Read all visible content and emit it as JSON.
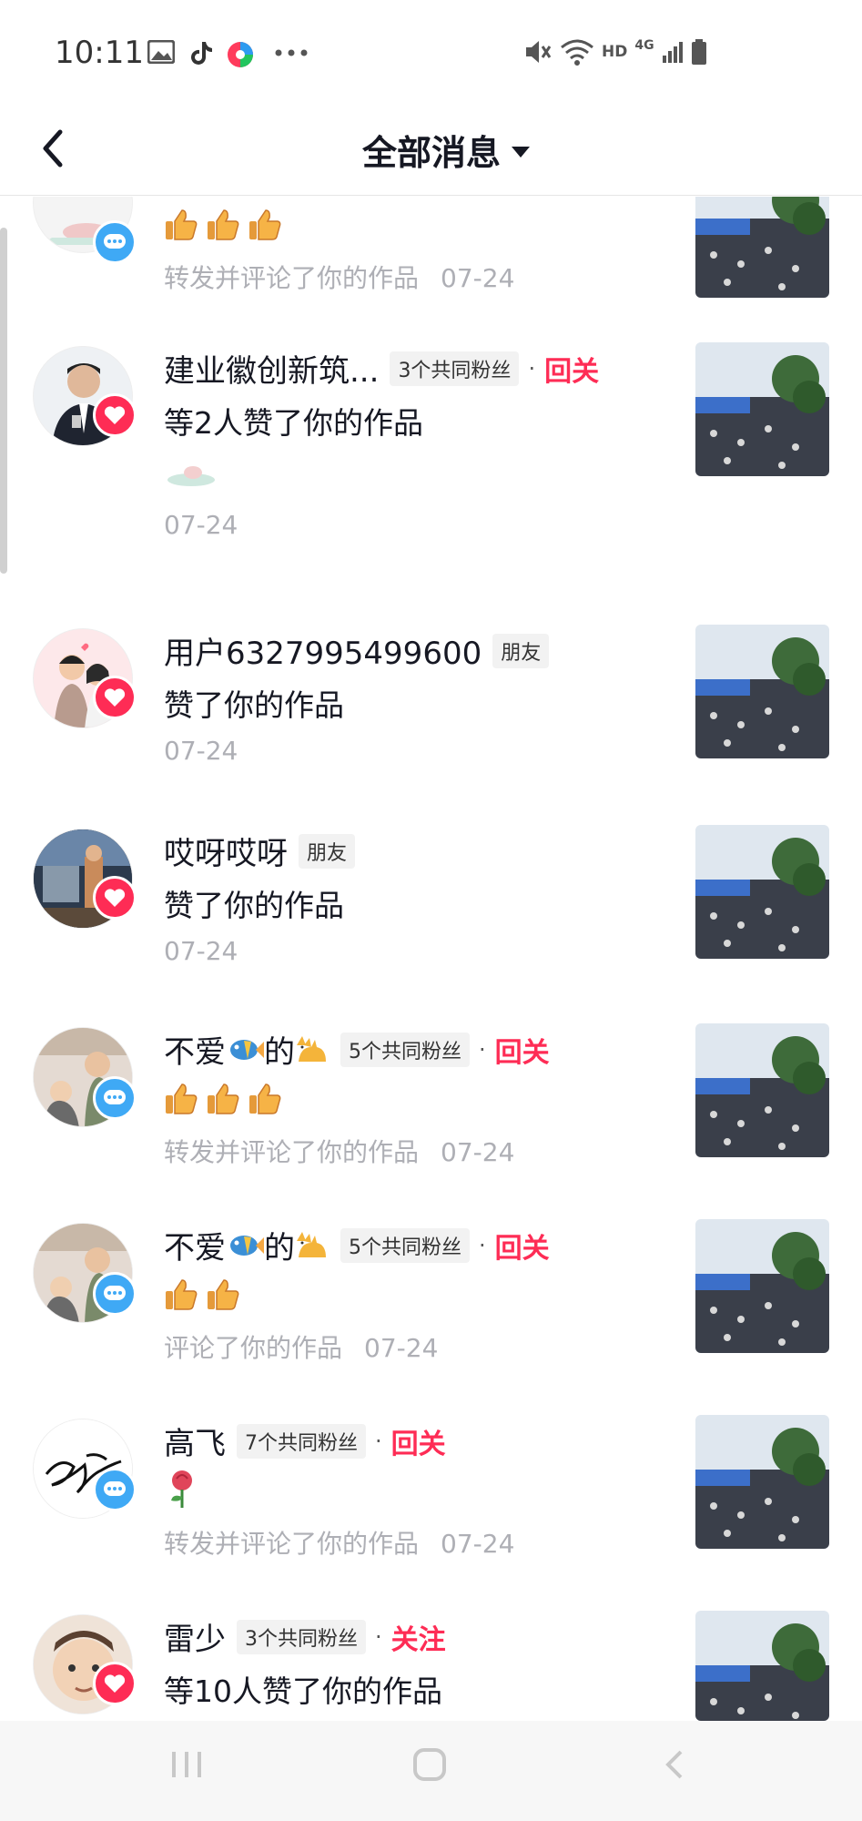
{
  "status_bar": {
    "time": "10:11",
    "network": "4G",
    "hd": "HD"
  },
  "header": {
    "title": "全部消息"
  },
  "messages": [
    {
      "name": "",
      "tag": "",
      "action": "",
      "content": "",
      "meta_action": "转发并评论了你的作品",
      "date": "07-24",
      "badge": "comment"
    },
    {
      "name": "建业徽创新筑...",
      "tag": "3个共同粉丝",
      "action": "回关",
      "content": "等2人赞了你的作品",
      "meta_action": "",
      "date": "07-24",
      "badge": "like"
    },
    {
      "name": "用户6327995499600",
      "tag": "朋友",
      "action": "",
      "content": "赞了你的作品",
      "meta_action": "",
      "date": "07-24",
      "badge": "like"
    },
    {
      "name": "哎呀哎呀",
      "tag": "朋友",
      "action": "",
      "content": "赞了你的作品",
      "meta_action": "",
      "date": "07-24",
      "badge": "like"
    },
    {
      "name_prefix": "不爱",
      "name_mid": "的",
      "tag": "5个共同粉丝",
      "action": "回关",
      "meta_action": "转发并评论了你的作品",
      "date": "07-24",
      "badge": "comment"
    },
    {
      "name_prefix": "不爱",
      "name_mid": "的",
      "tag": "5个共同粉丝",
      "action": "回关",
      "meta_action": "评论了你的作品",
      "date": "07-24",
      "badge": "comment"
    },
    {
      "name": "高飞",
      "tag": "7个共同粉丝",
      "action": "回关",
      "meta_action": "转发并评论了你的作品",
      "date": "07-24",
      "badge": "comment"
    },
    {
      "name": "雷少",
      "tag": "3个共同粉丝",
      "action": "关注",
      "content": "等10人赞了你的作品",
      "badge": "like"
    }
  ],
  "icons": {
    "like_color": "#fe2c55",
    "comment_color": "#3fa9f5",
    "accent": "#fe2c55"
  }
}
